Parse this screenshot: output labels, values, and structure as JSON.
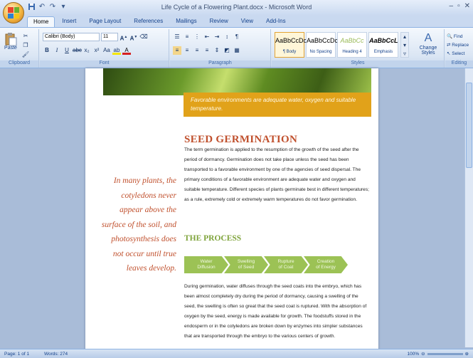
{
  "window": {
    "title": "Life Cycle of a Flowering Plant.docx - Microsoft Word",
    "controls": [
      "–",
      "▫",
      "✕"
    ]
  },
  "quick_access": [
    "save-icon",
    "undo-icon",
    "redo-icon"
  ],
  "tabs": [
    "Home",
    "Insert",
    "Page Layout",
    "References",
    "Mailings",
    "Review",
    "View",
    "Add-Ins"
  ],
  "ribbon": {
    "clipboard": {
      "paste": "Paste",
      "label": "Clipboard"
    },
    "font": {
      "name": "Calibri (Body)",
      "size": "11",
      "label": "Font"
    },
    "paragraph": {
      "label": "Paragraph"
    },
    "styles": {
      "label": "Styles",
      "items": [
        {
          "preview": "AaBbCcDc",
          "name": "¶ Body"
        },
        {
          "preview": "AaBbCcDc",
          "name": "No Spacing"
        },
        {
          "preview": "AaBbCc",
          "name": "Heading 4"
        },
        {
          "preview": "AaBbCcL",
          "name": "Emphasis"
        }
      ],
      "change_styles": "Change Styles"
    },
    "editing": {
      "label": "Editing",
      "find": "Find",
      "replace": "Replace",
      "select": "Select"
    }
  },
  "document": {
    "callout": "Favorable environments are adequate water, oxygen and suitable temperature.",
    "heading1": "SEED GERMINATION",
    "para1": "The term germination is applied to the resumption of the growth of the seed after the period of dormancy. Germination does not take place unless the seed has been transported to a favorable environment by one of the agencies of seed dispersal. The primary conditions of a favorable environment are adequate water and oxygen and suitable temperature. Different species of plants germinate best in different temperatures; as a rule, extremely cold or extremely warm temperatures do not favor germination.",
    "heading2": "THE PROCESS",
    "process_steps": [
      {
        "line1": "Water",
        "line2": "Diffusion"
      },
      {
        "line1": "Swelling",
        "line2": "of Seed"
      },
      {
        "line1": "Rupture",
        "line2": "of Coat"
      },
      {
        "line1": "Creation",
        "line2": "of Energy"
      }
    ],
    "para2": "During germination, water diffuses through the seed coats into the embryo, which has been almost completely dry during the period of dormancy, causing a swelling of the seed, the swelling is often so great that the seed coat is ruptured. With the absorption of oxygen by the seed, energy is made available for growth. The foodstuffs stored in the endosperm or in the cotyledons are broken down by enzymes into simpler substances that are transported through the embryo to the various centers of growth.",
    "pullquote": "In many plants, the cotyledons never appear above the surface of the soil, and photosynthesis does not occur until true leaves develop."
  },
  "status": {
    "page": "Page: 1 of 1",
    "words": "Words: 274",
    "zoom": "100%"
  },
  "colors": {
    "heading_red": "#c0502d",
    "process_green": "#7ea33a",
    "callout_orange": "#e1a21a"
  }
}
